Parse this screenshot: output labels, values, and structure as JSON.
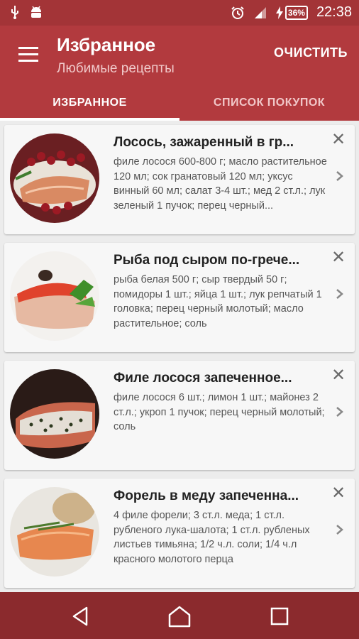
{
  "status": {
    "time": "22:38",
    "battery": "36%",
    "icons": [
      "usb-icon",
      "android-icon",
      "alarm-icon",
      "signal-icon",
      "charging-icon",
      "battery-icon"
    ]
  },
  "appbar": {
    "title": "Избранное",
    "subtitle": "Любимые рецепты",
    "clear_label": "ОЧИСТИТЬ"
  },
  "tabs": [
    {
      "label": "ИЗБРАННОЕ",
      "active": true
    },
    {
      "label": "СПИСОК ПОКУПОК",
      "active": false
    }
  ],
  "recipes": [
    {
      "title": "Лосось, зажаренный в гр...",
      "ingredients": "филе лосося 600-800 г; масло растительное 120 мл; сок гранатовый 120 мл; уксус винный 60 мл; салат 3-4 шт.; мед 2 ст.л.; лук зеленый 1 пучок; перец черный..."
    },
    {
      "title": "Рыба под сыром по-грече...",
      "ingredients": "рыба белая 500 г; сыр твердый 50 г; помидоры 1 шт.; яйца 1 шт.; лук репчатый 1 головка; перец черный молотый; масло растительное; соль"
    },
    {
      "title": "Филе лосося запеченное...",
      "ingredients": "филе лосося 6 шт.; лимон 1 шт.; майонез 2 ст.л.; укроп 1 пучок; перец черный молотый; соль"
    },
    {
      "title": "Форель в меду запеченна...",
      "ingredients": "4 филе форели; 3 ст.л. меда; 1 ст.л. рубленого лука-шалота; 1 ст.л. рубленых листьев тимьяна; 1/2 ч.л. соли; 1/4 ч.л красного молотого перца"
    }
  ],
  "colors": {
    "appbar": "#b23a3e",
    "statusbar": "#a33437",
    "navbar": "#8b2a2d"
  }
}
